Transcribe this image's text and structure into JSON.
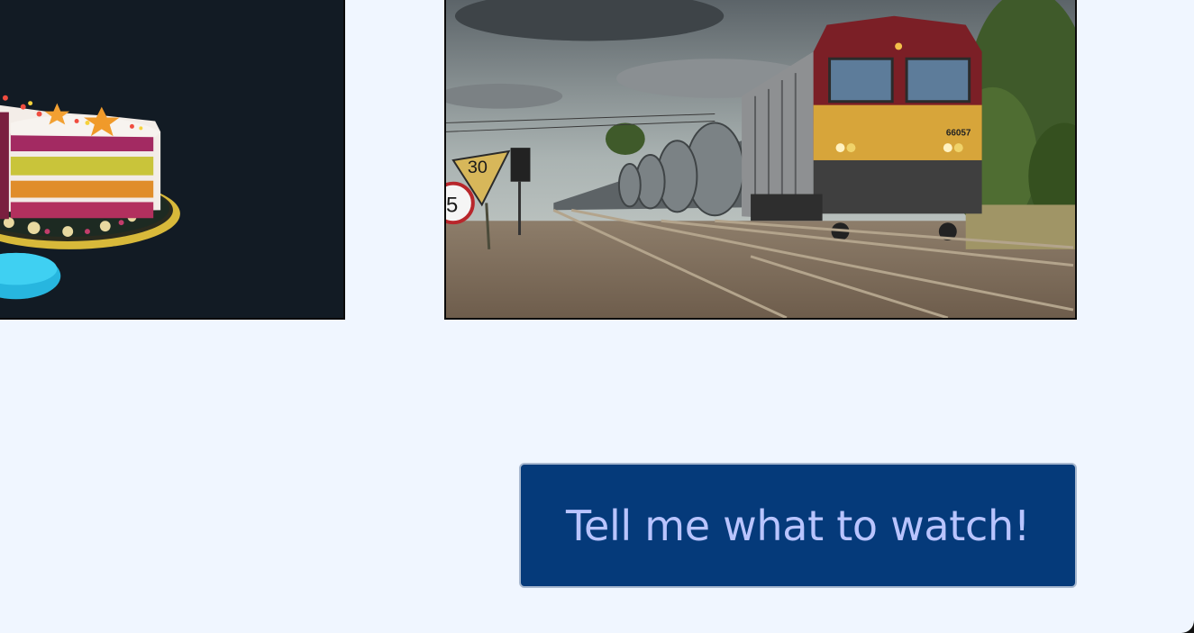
{
  "gallery": {
    "items": [
      {
        "subject": "layered rainbow cake on a cake stand"
      },
      {
        "subject": "freight locomotive pulling tank wagons on railway tracks",
        "signs": [
          "30",
          "5"
        ],
        "loco_number": "66057"
      }
    ]
  },
  "cta": {
    "label": "Tell me what to watch!"
  },
  "colors": {
    "page_background": "#f0f6ff",
    "button_background": "#053a7a",
    "button_text": "#b9c4ff",
    "button_border": "#a8b8cf"
  },
  "icons": [
    "cake-photo",
    "train-photo"
  ]
}
